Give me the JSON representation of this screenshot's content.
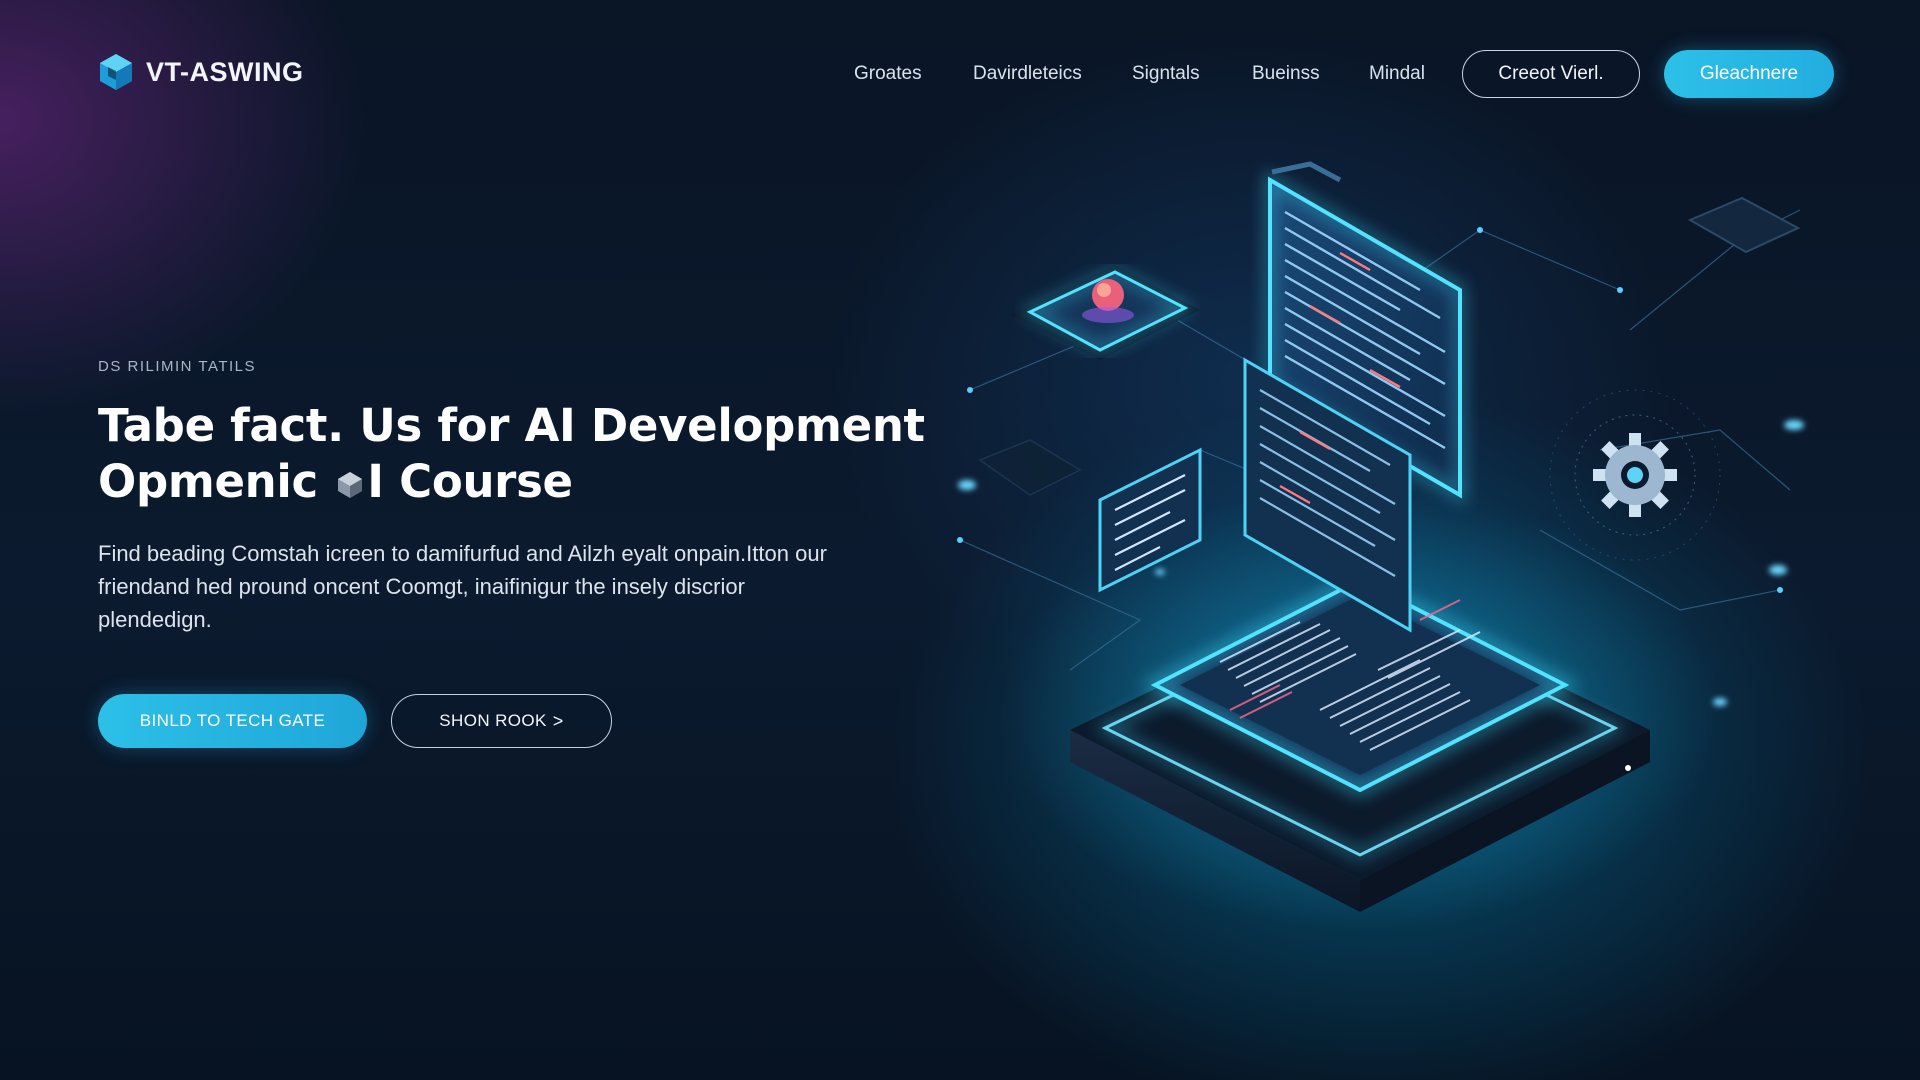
{
  "brand": {
    "name": "VT-ASWING",
    "logo_icon": "hexagon-cube-icon"
  },
  "nav": {
    "links": [
      {
        "label": "Groates"
      },
      {
        "label": "Davirdleteics"
      },
      {
        "label": "Signtals"
      },
      {
        "label": "Bueinss"
      },
      {
        "label": "Mindal"
      }
    ],
    "outline_button": "Creeot Vierl.",
    "cta_button": "Gleachnere"
  },
  "hero": {
    "eyebrow": "DS RILIMIN TATILS",
    "headline_line1": "Tabe fact. Us for AI Development",
    "headline_line2_before": "Opmenic",
    "headline_line2_after": "I Course",
    "lead": "Find beading Comstah icreen to damifurfud and Ailzh eyalt onpain.Itton our friendand hed pround oncent Coomgt, inaifinigur the insely discrior plendedign.",
    "primary_button": "BINLD TO TECH GATE",
    "secondary_button": "SHON ROOK",
    "secondary_arrow": ">"
  },
  "colors": {
    "accent": "#2cc0e8",
    "background": "#0a1424",
    "glow": "#3fe0ff"
  },
  "illustration": {
    "icons": [
      "circuit-board-platform-icon",
      "code-panel-icon",
      "ai-chip-icon",
      "gear-icon",
      "data-card-icon"
    ]
  }
}
